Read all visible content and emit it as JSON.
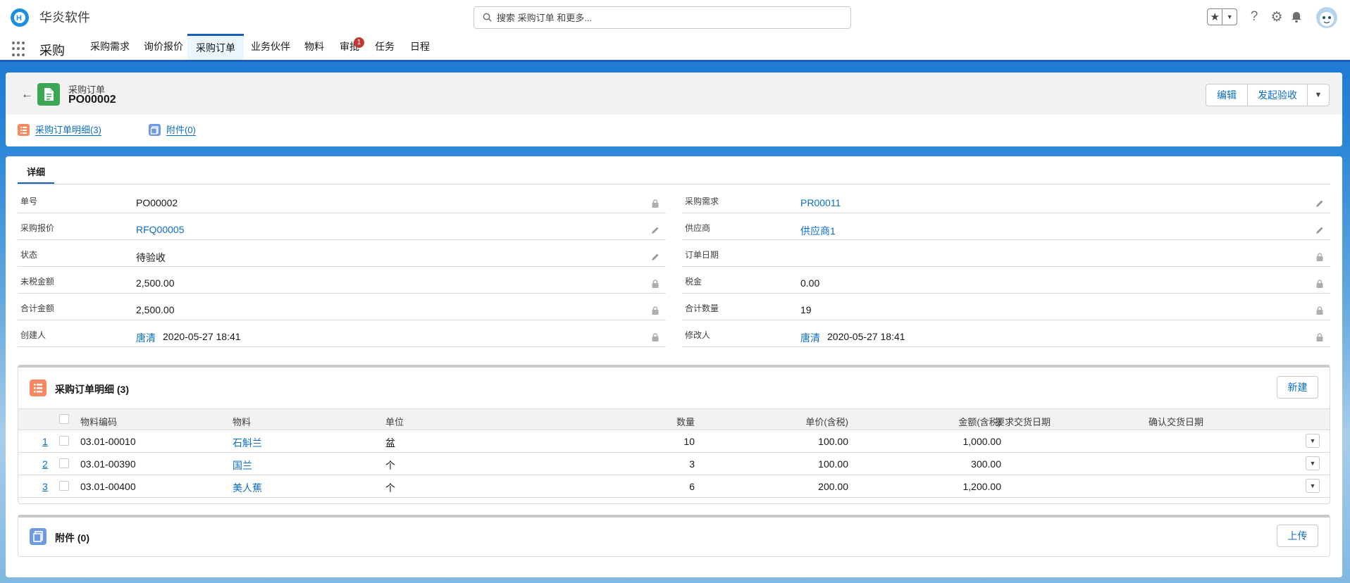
{
  "header": {
    "app_name": "华炎软件",
    "search_placeholder": "搜索 采购订单 和更多...",
    "icons": [
      "star-icon",
      "help-icon",
      "gear-icon",
      "bell-icon",
      "avatar"
    ]
  },
  "nav": {
    "app_label": "采购",
    "tabs": [
      {
        "label": "采购需求"
      },
      {
        "label": "询价报价"
      },
      {
        "label": "采购订单",
        "active": true
      },
      {
        "label": "业务伙伴"
      },
      {
        "label": "物料"
      },
      {
        "label": "审批",
        "badge": "1"
      },
      {
        "label": "任务"
      },
      {
        "label": "日程"
      }
    ]
  },
  "record": {
    "object_type": "采购订单",
    "name": "PO00002",
    "actions": {
      "edit": "编辑",
      "start_inspection": "发起验收"
    },
    "related_links": [
      {
        "label": "采购订单明细(3)"
      },
      {
        "label": "附件(0)"
      }
    ]
  },
  "detail": {
    "tab_label": "详细",
    "left_fields": [
      {
        "label": "单号",
        "value": "PO00002",
        "link": false,
        "icon": "lock-icon"
      },
      {
        "label": "采购报价",
        "value": "RFQ00005",
        "link": true,
        "icon": "pencil-icon"
      },
      {
        "label": "状态",
        "value": "待验收",
        "link": false,
        "icon": "pencil-icon"
      },
      {
        "label": "未税金额",
        "value": "2,500.00",
        "link": false,
        "icon": "lock-icon"
      },
      {
        "label": "合计金额",
        "value": "2,500.00",
        "link": false,
        "icon": "lock-icon"
      },
      {
        "label": "创建人",
        "value": "唐清",
        "value2": "2020-05-27 18:41",
        "link": true,
        "icon": "lock-icon"
      }
    ],
    "right_fields": [
      {
        "label": "采购需求",
        "value": "PR00011",
        "link": true,
        "icon": "pencil-icon"
      },
      {
        "label": "供应商",
        "value": "供应商1",
        "link": true,
        "icon": "pencil-icon"
      },
      {
        "label": "订单日期",
        "value": "",
        "link": false,
        "icon": "lock-icon"
      },
      {
        "label": "税金",
        "value": "0.00",
        "link": false,
        "icon": "lock-icon"
      },
      {
        "label": "合计数量",
        "value": "19",
        "link": false,
        "icon": "lock-icon"
      },
      {
        "label": "修改人",
        "value": "唐清",
        "value2": "2020-05-27 18:41",
        "link": true,
        "icon": "lock-icon"
      }
    ]
  },
  "order_lines": {
    "title": "采购订单明细 (3)",
    "new_button": "新建",
    "columns": [
      "物料编码",
      "物料",
      "单位",
      "数量",
      "单价(含税)",
      "金额(含税)",
      "要求交货日期",
      "确认交货日期"
    ],
    "rows": [
      {
        "no": "1",
        "code": "03.01-00010",
        "material": "石斛兰",
        "unit": "盆",
        "qty": "10",
        "price": "100.00",
        "amount": "1,000.00",
        "req_date": "",
        "confirm_date": ""
      },
      {
        "no": "2",
        "code": "03.01-00390",
        "material": "国兰",
        "unit": "个",
        "qty": "3",
        "price": "100.00",
        "amount": "300.00",
        "req_date": "",
        "confirm_date": ""
      },
      {
        "no": "3",
        "code": "03.01-00400",
        "material": "美人蕉",
        "unit": "个",
        "qty": "6",
        "price": "200.00",
        "amount": "1,200.00",
        "req_date": "",
        "confirm_date": ""
      }
    ]
  },
  "attachments": {
    "title": "附件 (0)",
    "upload_button": "上传"
  },
  "colors": {
    "brand_blue": "#1b5dbc",
    "link": "#0b6ec5",
    "record_icon": "#3ba755",
    "lines_icon": "#f88962",
    "attachments_icon": "#6f9ae0",
    "badge_red": "#c23934"
  }
}
